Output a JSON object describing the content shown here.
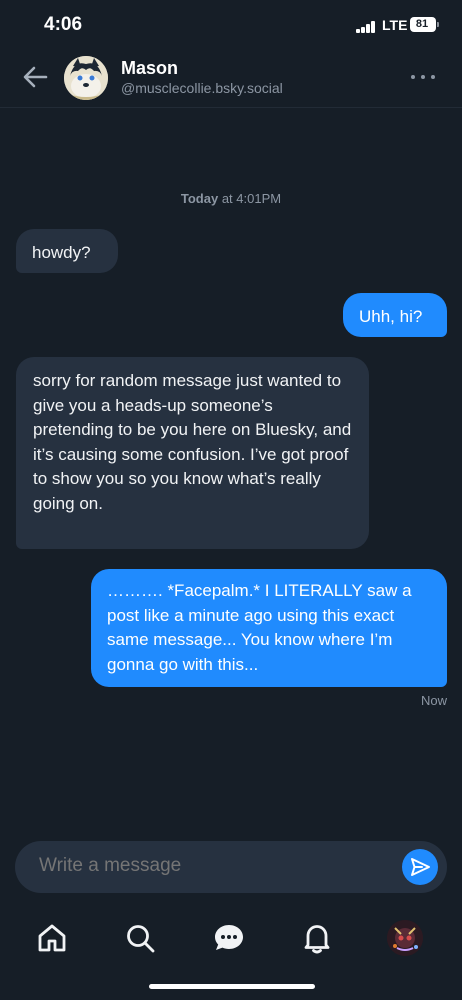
{
  "status_bar": {
    "time": "4:06",
    "network": "LTE",
    "battery": "81"
  },
  "header": {
    "name": "Mason",
    "handle": "@musclecollie.bsky.social"
  },
  "conversation": {
    "date_label_day": "Today",
    "date_label_rest": " at 4:01PM",
    "messages": [
      {
        "direction": "incoming",
        "text": "howdy?"
      },
      {
        "direction": "outgoing",
        "text": "Uhh, hi?"
      },
      {
        "direction": "incoming",
        "text": "sorry for random message just wanted to give you a heads-up someone’s pretending to be you here on Bluesky, and it’s causing some confusion. I’ve got proof to show you so you know what’s really going on."
      },
      {
        "direction": "outgoing",
        "text": "………. *Facepalm.* I LITERALLY saw a post like a minute ago using this exact same message... You know where I’m gonna go with this..."
      }
    ],
    "last_message_time": "Now"
  },
  "composer": {
    "placeholder": "Write a message"
  },
  "tabbar": {
    "items": [
      "home-icon",
      "search-icon",
      "chat-icon",
      "bell-icon",
      "profile-avatar"
    ]
  },
  "colors": {
    "background": "#161e27",
    "incoming_bubble": "#263140",
    "outgoing_bubble": "#208bfe",
    "muted_text": "#8c96a3"
  }
}
